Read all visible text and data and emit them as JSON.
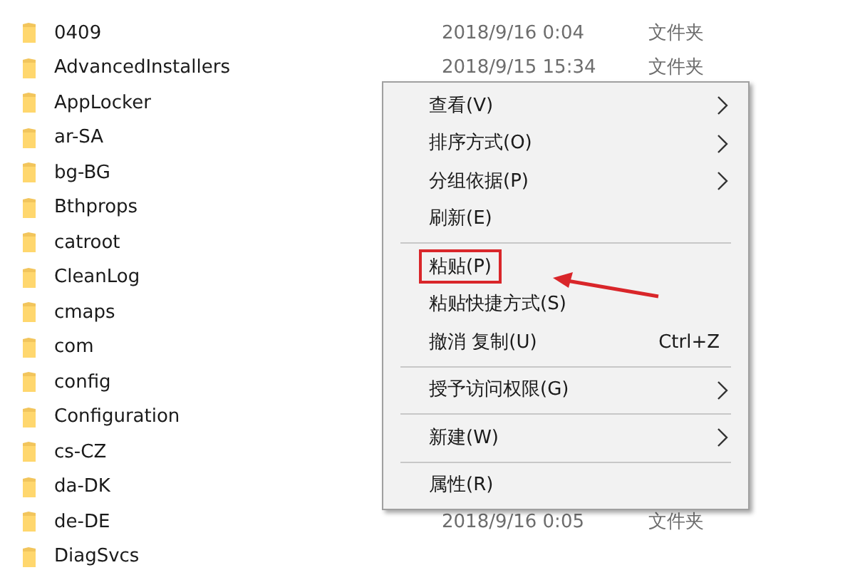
{
  "files": [
    {
      "name": "0409",
      "date": "2018/9/16 0:04",
      "type": "文件夹"
    },
    {
      "name": "AdvancedInstallers",
      "date": "2018/9/15 15:34",
      "type": "文件夹"
    },
    {
      "name": "AppLocker"
    },
    {
      "name": "ar-SA"
    },
    {
      "name": "bg-BG"
    },
    {
      "name": "Bthprops"
    },
    {
      "name": "catroot"
    },
    {
      "name": "CleanLog"
    },
    {
      "name": "cmaps"
    },
    {
      "name": "com"
    },
    {
      "name": "config"
    },
    {
      "name": "Configuration"
    },
    {
      "name": "cs-CZ"
    },
    {
      "name": "da-DK"
    },
    {
      "name": "de-DE",
      "date": "2018/9/16 0:05",
      "type": "文件夹"
    },
    {
      "name": "DiagSvcs"
    }
  ],
  "context_menu": [
    {
      "kind": "item",
      "label": "查看(V)",
      "submenu": true,
      "annotated": false
    },
    {
      "kind": "item",
      "label": "排序方式(O)",
      "submenu": true,
      "annotated": false
    },
    {
      "kind": "item",
      "label": "分组依据(P)",
      "submenu": true,
      "annotated": false
    },
    {
      "kind": "item",
      "label": "刷新(E)",
      "submenu": false,
      "annotated": false
    },
    {
      "kind": "separator"
    },
    {
      "kind": "item",
      "label": "粘贴(P)",
      "submenu": false,
      "annotated": true
    },
    {
      "kind": "item",
      "label": "粘贴快捷方式(S)",
      "submenu": false,
      "annotated": false
    },
    {
      "kind": "item",
      "label": "撤消 复制(U)",
      "shortcut": "Ctrl+Z",
      "submenu": false,
      "annotated": false
    },
    {
      "kind": "separator"
    },
    {
      "kind": "item",
      "label": "授予访问权限(G)",
      "submenu": true,
      "annotated": false
    },
    {
      "kind": "separator"
    },
    {
      "kind": "item",
      "label": "新建(W)",
      "submenu": true,
      "annotated": false
    },
    {
      "kind": "separator"
    },
    {
      "kind": "item",
      "label": "属性(R)",
      "submenu": false,
      "annotated": false
    }
  ]
}
